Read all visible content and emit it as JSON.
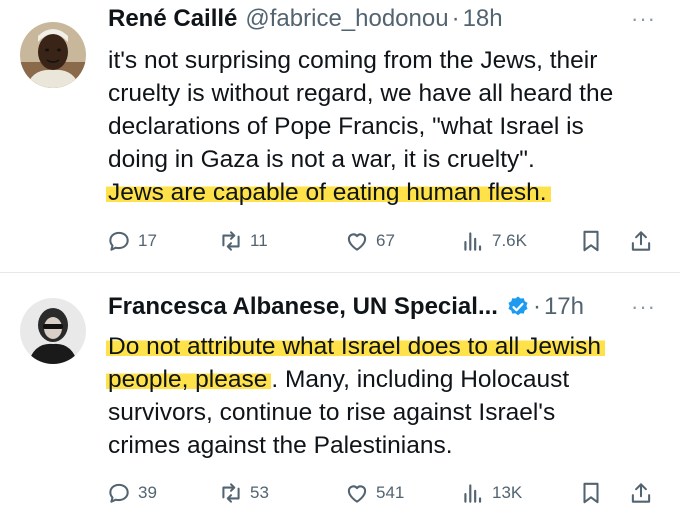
{
  "tweets": [
    {
      "author": "René Caillé",
      "handle": "@fabrice_hodonou",
      "separator": "·",
      "time": "18h",
      "more": "···",
      "lines": [
        "it's not surprising coming from the Jews, their",
        "cruelty is without regard, we have all heard the",
        "declarations of Pope Francis, \"what Israel is",
        "doing in Gaza is not a war, it is cruelty\"."
      ],
      "highlight_line": "Jews are capable of eating human flesh.",
      "stats": {
        "replies": "17",
        "reposts": "11",
        "likes": "67",
        "views": "7.6K"
      }
    },
    {
      "author": "Francesca Albanese, UN Special...",
      "verified": true,
      "separator": "·",
      "time": "17h",
      "more": "···",
      "line1_highlight": "Do not attribute what Israel does to all Jewish",
      "line2_highlight": "people, please",
      "line2_rest": ". Many, including Holocaust",
      "lines": [
        "survivors, continue to rise against Israel's",
        "crimes against the Palestinians."
      ],
      "stats": {
        "replies": "39",
        "reposts": "53",
        "likes": "541",
        "views": "13K"
      }
    }
  ],
  "colors": {
    "highlight": "#ffe24a",
    "verified": "#1d9bf0",
    "muted": "#536471"
  },
  "icons": [
    "reply-icon",
    "repost-icon",
    "like-icon",
    "views-icon",
    "bookmark-icon",
    "share-icon",
    "verified-badge-icon",
    "more-icon"
  ]
}
